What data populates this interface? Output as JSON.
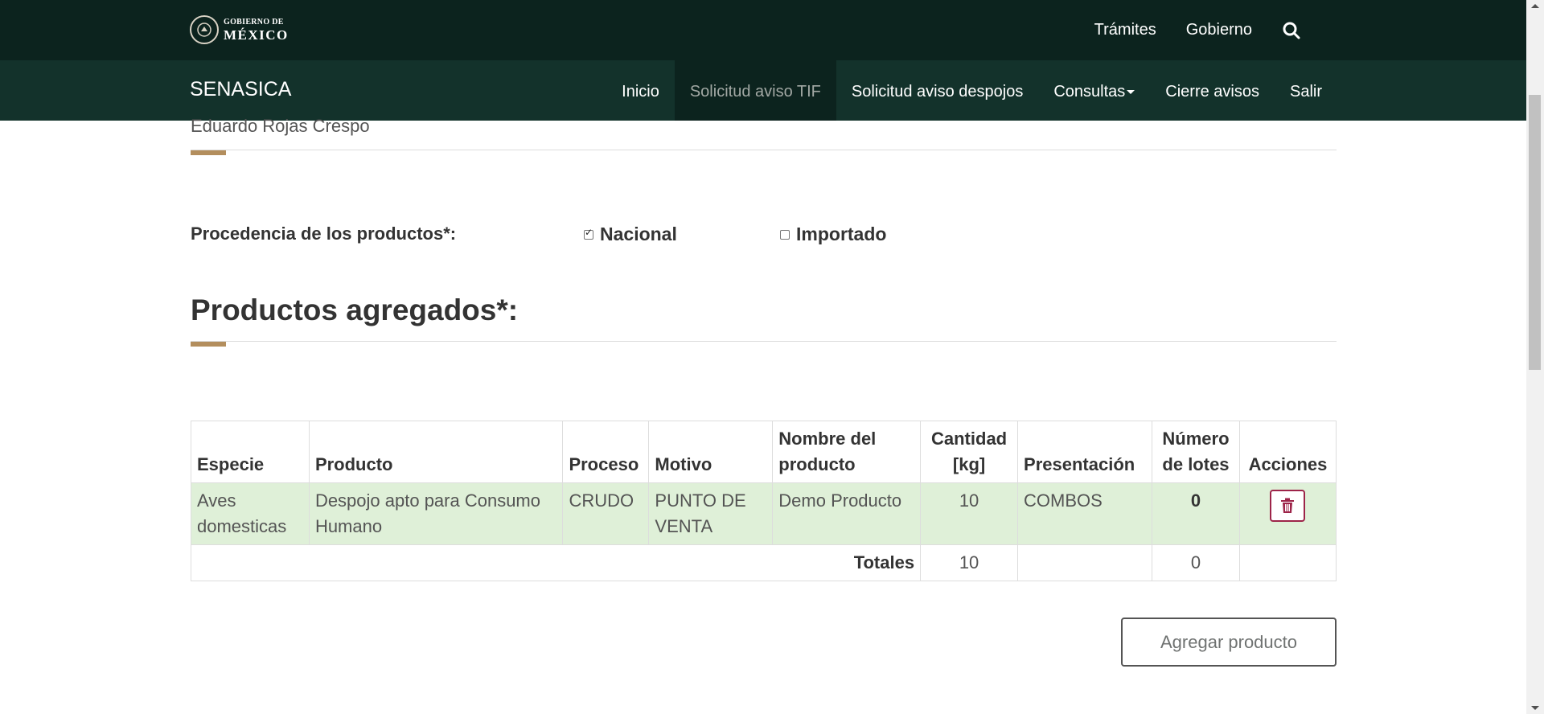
{
  "gov_header": {
    "logo_line1": "GOBIERNO DE",
    "logo_line2": "MÉXICO",
    "links": [
      "Trámites",
      "Gobierno"
    ],
    "search_icon": "search-icon"
  },
  "nav": {
    "brand": "SENASICA",
    "items": [
      "Inicio",
      "Solicitud aviso TIF",
      "Solicitud aviso despojos",
      "Consultas",
      "Cierre avisos",
      "Salir"
    ],
    "active_index": 1
  },
  "main": {
    "user_name": "Eduardo Rojas Crespo",
    "procedencia_label": "Procedencia de los productos*:",
    "options": [
      {
        "label": "Nacional",
        "checked": true
      },
      {
        "label": "Importado",
        "checked": false
      }
    ],
    "section_title": "Productos agregados*:",
    "table": {
      "headers": [
        "Especie",
        "Producto",
        "Proceso",
        "Motivo",
        "Nombre del producto",
        "Cantidad [kg]",
        "Presentación",
        "Número de lotes",
        "Acciones"
      ],
      "rows": [
        {
          "especie": "Aves domesticas",
          "producto": "Despojo apto para Consumo Humano",
          "proceso": "CRUDO",
          "motivo": "PUNTO DE VENTA",
          "nombre": "Demo Producto",
          "cantidad": "10",
          "presentacion": "COMBOS",
          "lotes": "0"
        }
      ],
      "totals_label": "Totales",
      "totals_cantidad": "10",
      "totals_lotes": "0"
    },
    "add_button": "Agregar producto"
  },
  "colors": {
    "gov_bar": "#0c231e",
    "nav_bar": "#13322b",
    "accent": "#b38e5d",
    "row_success": "#dff0d8",
    "danger": "#9d2449"
  }
}
